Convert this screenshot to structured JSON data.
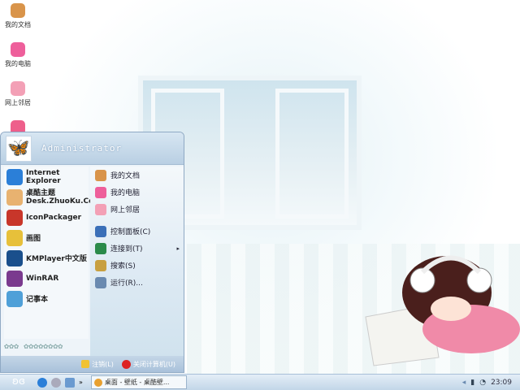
{
  "desktop_icons": [
    {
      "label": "我的文档",
      "color": "#d9944a"
    },
    {
      "label": "我的电脑",
      "color": "#ee5f9b"
    },
    {
      "label": "网上邻居",
      "color": "#f3a0b6"
    },
    {
      "label": "",
      "color": "#ee5f8b"
    }
  ],
  "start_menu": {
    "user": "Administrator",
    "pinned": [
      {
        "label": "Internet Explorer",
        "icon": "ie-icon",
        "color": "#2b7fd8"
      },
      {
        "label": "桌酷主题\nDesk.ZhuoKu.Com",
        "line1": "桌酷主题",
        "line2": "Desk.ZhuoKu.Com",
        "icon": "zhuoku-icon",
        "color": "#e8b270"
      },
      {
        "label": "IconPackager",
        "icon": "iconpackager-icon",
        "color": "#c8362a"
      },
      {
        "label": "画图",
        "icon": "paint-icon",
        "color": "#e7c03a"
      },
      {
        "label": "KMPlayer中文版",
        "icon": "kmplayer-icon",
        "color": "#1a4f8c"
      },
      {
        "label": "WinRAR",
        "icon": "winrar-icon",
        "color": "#7a3a8e"
      },
      {
        "label": "记事本",
        "icon": "notepad-icon",
        "color": "#4fa0d8"
      }
    ],
    "right": [
      {
        "label": "我的文档",
        "icon": "my-documents-icon",
        "color": "#d9944a"
      },
      {
        "label": "我的电脑",
        "icon": "my-computer-icon",
        "color": "#ee5f9b"
      },
      {
        "label": "网上邻居",
        "icon": "network-icon",
        "color": "#f3a0b6"
      },
      {
        "label": "控制面板(C)",
        "icon": "control-panel-icon",
        "color": "#3a6fb8"
      },
      {
        "label": "连接到(T)",
        "icon": "connect-icon",
        "color": "#2a8a4a",
        "submenu": true
      },
      {
        "label": "搜索(S)",
        "icon": "search-icon",
        "color": "#c8a040"
      },
      {
        "label": "运行(R)...",
        "icon": "run-icon",
        "color": "#6a8ab0"
      }
    ],
    "logoff": "注销(L)",
    "shutdown": "关闭计算机(U)"
  },
  "taskbar": {
    "task": "桌面 - 壁纸 - 桌酷壁...",
    "clock": "23:09"
  }
}
